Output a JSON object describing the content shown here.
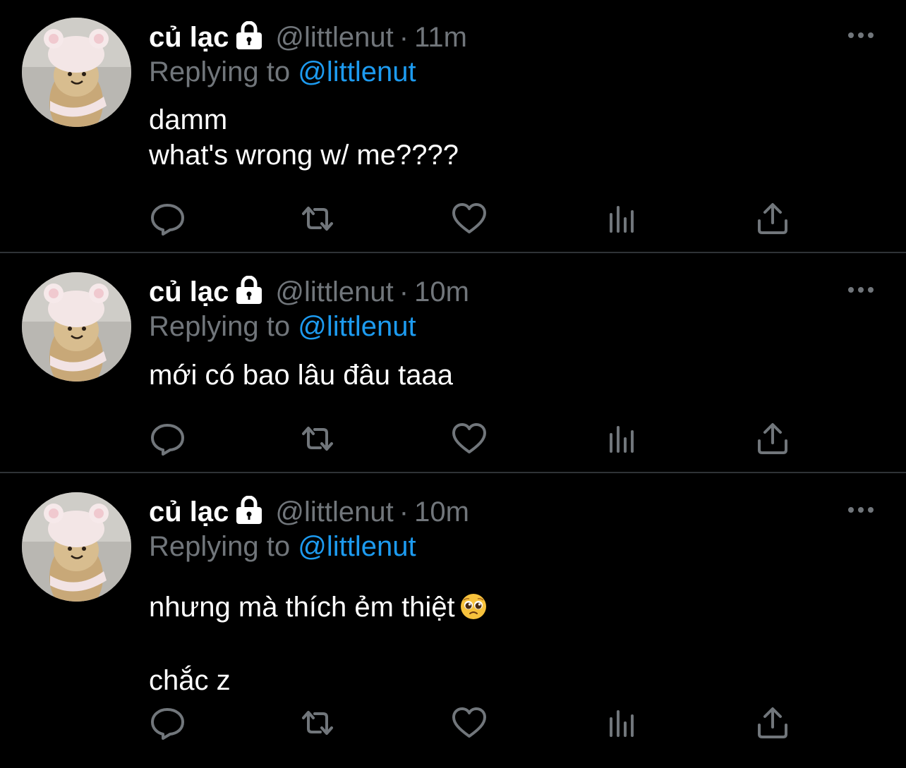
{
  "tweets": [
    {
      "display_name": "củ lạc",
      "handle": "@littlenut",
      "separator": "·",
      "time": "11m",
      "replying_prefix": "Replying to",
      "replying_to": "@littlenut",
      "lines": [
        "damm",
        "what's wrong w/ me????"
      ]
    },
    {
      "display_name": "củ lạc",
      "handle": "@littlenut",
      "separator": "·",
      "time": "10m",
      "replying_prefix": "Replying to",
      "replying_to": "@littlenut",
      "lines": [
        "mới có bao lâu đâu taaa"
      ]
    },
    {
      "display_name": "củ lạc",
      "handle": "@littlenut",
      "separator": "·",
      "time": "10m",
      "replying_prefix": "Replying to",
      "replying_to": "@littlenut",
      "lines": [
        "nhưng mà thích ẻm thiệt",
        "",
        "chắc z"
      ],
      "emoji": "pleading-face-emoji"
    }
  ],
  "icons": {
    "lock": "lock-icon",
    "more": "more-options-icon",
    "reply": "reply-icon",
    "retweet": "retweet-icon",
    "like": "heart-icon",
    "views": "views-icon",
    "share": "share-icon"
  },
  "colors": {
    "background": "#000000",
    "text": "#ffffff",
    "secondary": "#71767b",
    "link": "#1d9bf0",
    "divider": "#2f3336"
  }
}
